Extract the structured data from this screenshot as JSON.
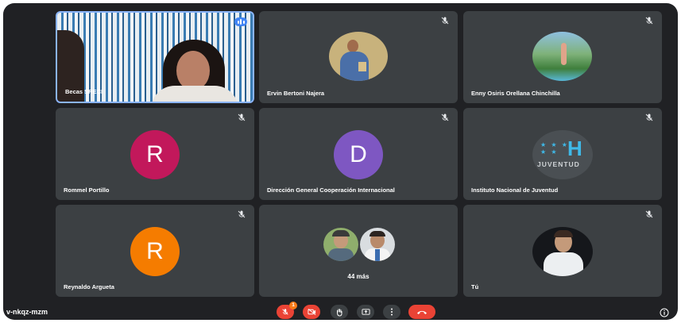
{
  "meeting": {
    "code": "v-nkqz-mzm"
  },
  "participants": [
    {
      "name": "Becas SRECI"
    },
    {
      "name": "Ervin Bertoni Najera"
    },
    {
      "name": "Enny Osiris Orellana Chinchilla"
    },
    {
      "name": "Rommel Portillo",
      "initial": "R",
      "color": "#c2185b"
    },
    {
      "name": "Dirección General Cooperación Internacional",
      "initial": "D",
      "color": "#7e57c2"
    },
    {
      "name": "Instituto Nacional de Juventud",
      "logo_letter": "H",
      "logo_text": "JUVENTUD"
    },
    {
      "name": "Reynaldo Argueta",
      "initial": "R",
      "color": "#f57c00"
    },
    {
      "name": "Tú"
    }
  ],
  "others": {
    "label": "44 más"
  },
  "controls": {
    "mic_badge": "1"
  },
  "colors": {
    "background": "#202124",
    "tile": "#3c4043",
    "end_call": "#ea4335",
    "active_border": "#8ab4f8"
  }
}
